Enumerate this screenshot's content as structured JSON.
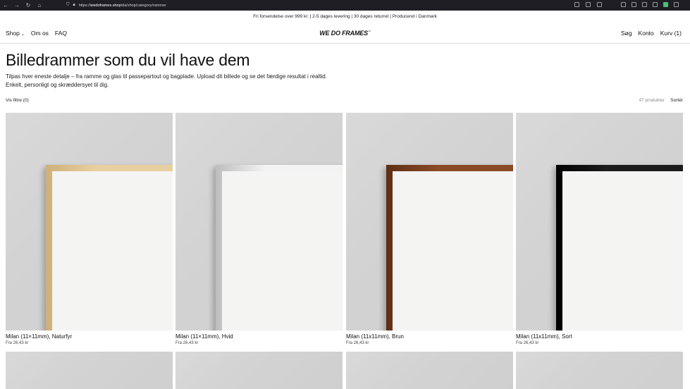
{
  "browser": {
    "url_prefix": "https://",
    "url_domain": "wedoframes.shop",
    "url_path": "/da/shop/category/rammer"
  },
  "announcement": "Fri forsendelse over 999 kr. | 2-5 dages levering | 30 dages returret | Produceret i Danmark",
  "header": {
    "nav": [
      {
        "label": "Shop",
        "has_dropdown": true
      },
      {
        "label": "Om os"
      },
      {
        "label": "FAQ"
      }
    ],
    "logo": "WE DO FRAMES",
    "logo_mark": "™",
    "right": [
      {
        "label": "Søg"
      },
      {
        "label": "Konto"
      },
      {
        "label": "Kurv (1)"
      }
    ]
  },
  "hero": {
    "title": "Billedrammer som du vil have dem",
    "description_line1": "Tilpas hver eneste detalje – fra ramme og glas til passepartout og bagplade. Upload dit billede og se det færdige resultat i realtid.",
    "description_line2": "Enkelt, personligt og skræddersyet til dig."
  },
  "toolbar": {
    "filter_label": "Vis filtre (0)",
    "product_count": "47 produkter",
    "sort_label": "Sortér"
  },
  "products": [
    {
      "name": "Milan (11×11mm), Naturfyr",
      "price": "Fra 26,43 kr",
      "frame_color": "#e8cf9f",
      "frame_shade": "#cdb07a"
    },
    {
      "name": "Milan (11×11mm), Hvid",
      "price": "Fra 26,43 kr",
      "frame_color": "#f3f3f3",
      "frame_shade": "#bdbdbd"
    },
    {
      "name": "Milan (11x11mm), Brun",
      "price": "Fra 26,43 kr",
      "frame_color": "#8a4a26",
      "frame_shade": "#5d2f15"
    },
    {
      "name": "Milan (11x11mm), Sort",
      "price": "Fra 26,43 kr",
      "frame_color": "#1b1b1b",
      "frame_shade": "#000000"
    }
  ]
}
